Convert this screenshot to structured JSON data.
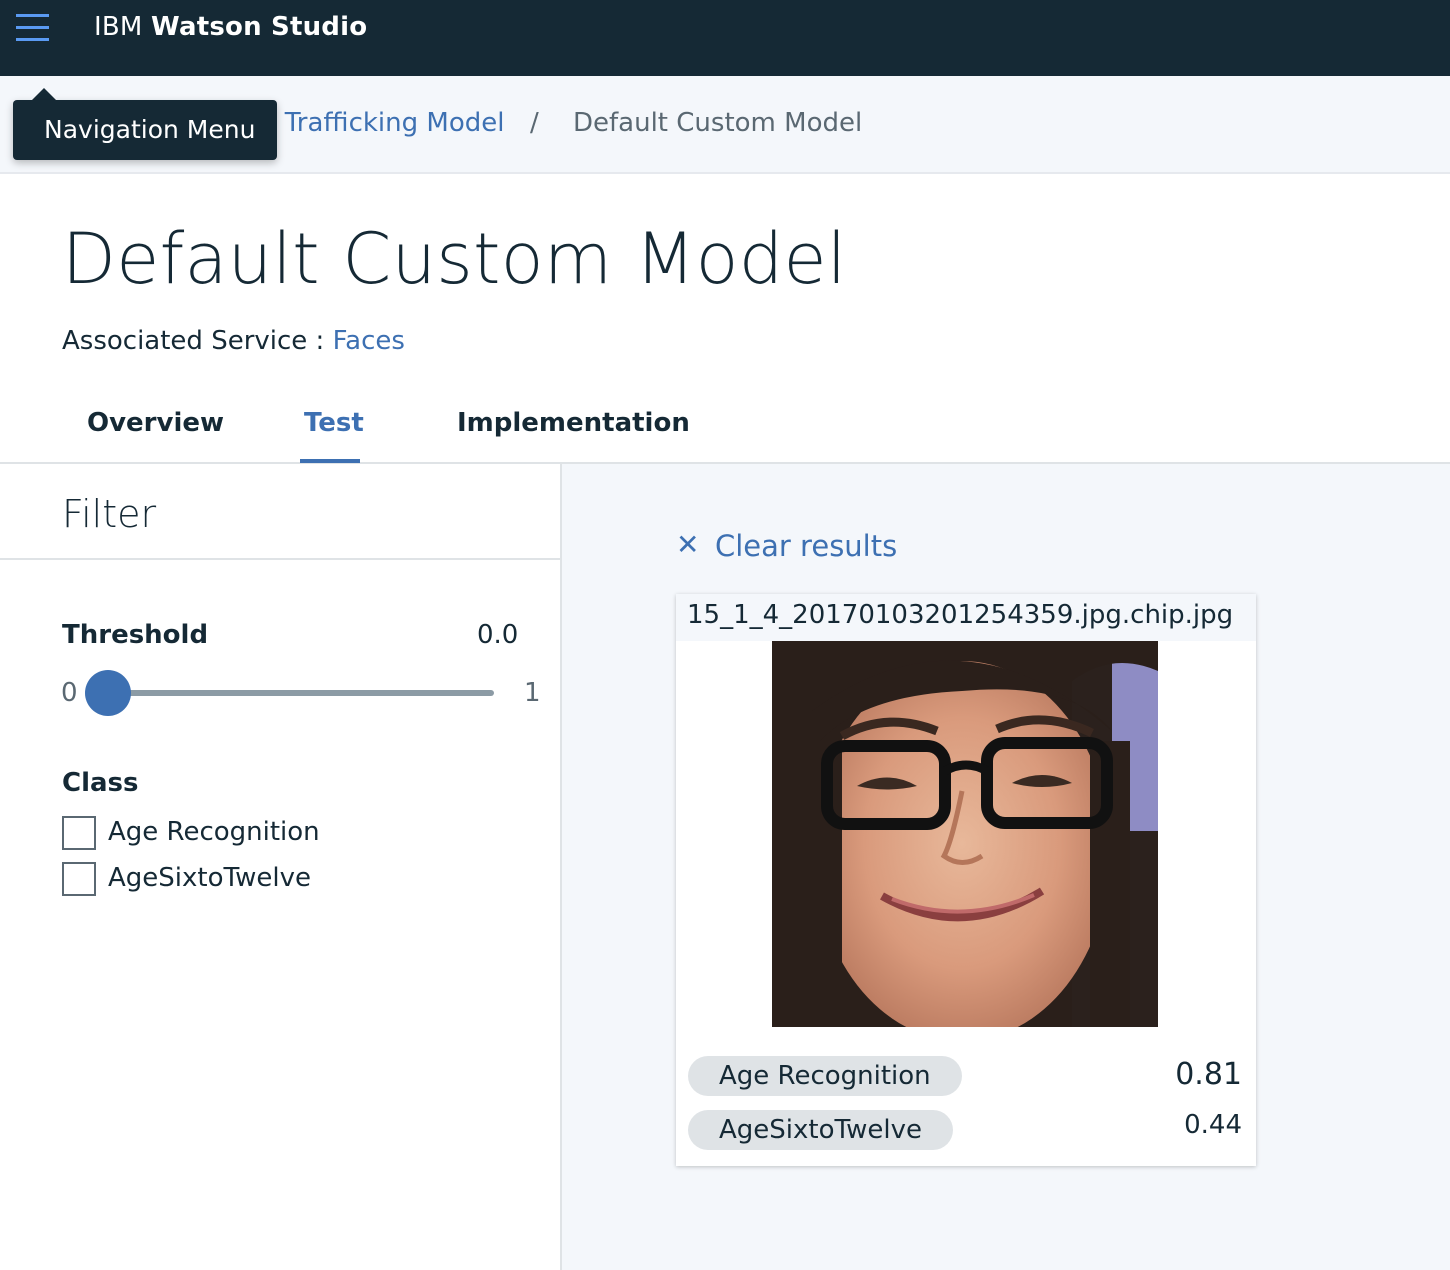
{
  "topbar": {
    "brand_prefix": "IBM",
    "brand_name": "Watson Studio",
    "menu_icon": "hamburger-menu-icon"
  },
  "tooltip": {
    "text": "Navigation Menu"
  },
  "breadcrumb": {
    "parent": "n Trafficking Model",
    "separator": "/",
    "current": "Default Custom Model"
  },
  "page": {
    "title": "Default Custom Model",
    "associated_label": "Associated Service : ",
    "associated_link": "Faces"
  },
  "tabs": [
    {
      "label": "Overview",
      "active": false
    },
    {
      "label": "Test",
      "active": true
    },
    {
      "label": "Implementation",
      "active": false
    }
  ],
  "filter": {
    "title": "Filter",
    "threshold": {
      "label": "Threshold",
      "value": "0.0",
      "min": "0",
      "max": "1",
      "level": 0.0
    },
    "class": {
      "label": "Class",
      "options": [
        {
          "label": "Age Recognition",
          "checked": false
        },
        {
          "label": "AgeSixtoTwelve",
          "checked": false
        }
      ]
    }
  },
  "results": {
    "clear_icon": "close-icon",
    "clear_label": "Clear results",
    "card": {
      "filename": "15_1_4_20170103201254359.jpg.chip.jpg",
      "image_content": "face-photo",
      "scores": [
        {
          "class": "Age Recognition",
          "score": "0.81"
        },
        {
          "class": "AgeSixtoTwelve",
          "score": "0.44"
        }
      ]
    }
  },
  "colors": {
    "topbar": "#152935",
    "accent": "#3d70b2",
    "menu_icon": "#5a9af2",
    "panel_bg": "#f4f7fb",
    "tag_bg": "#dfe3e6"
  }
}
